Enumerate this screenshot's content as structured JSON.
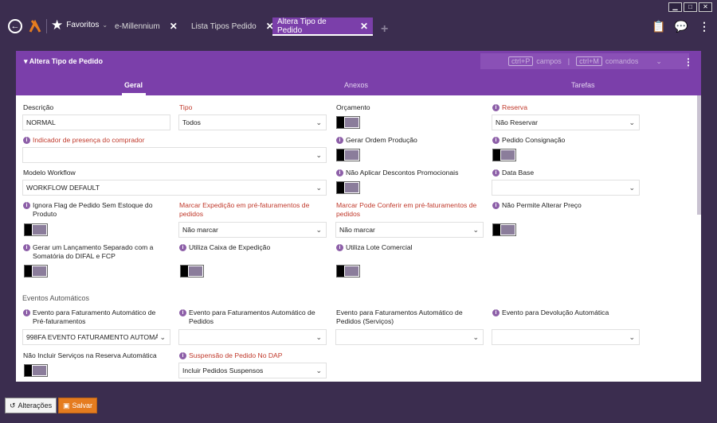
{
  "window": {
    "min": "▁",
    "max": "□",
    "close": "✕"
  },
  "nav": {
    "favorites_label": "Favoritos",
    "tabs": [
      {
        "label": "e-Millennium"
      },
      {
        "label": "Lista Tipos Pedido"
      },
      {
        "label": "Altera Tipo de Pedido"
      }
    ]
  },
  "panel": {
    "title": "Altera Tipo de Pedido",
    "shortcut_key1": "ctrl+P",
    "shortcut_label1": "campos",
    "shortcut_sep": "|",
    "shortcut_key2": "ctrl+M",
    "shortcut_label2": "comandos",
    "subtabs": [
      "Geral",
      "Anexos",
      "Tarefas"
    ]
  },
  "form": {
    "descricao_label": "Descrição",
    "descricao_value": "NORMAL",
    "tipo_label": "Tipo",
    "tipo_value": "Todos",
    "orcamento_label": "Orçamento",
    "reserva_label": "Reserva",
    "reserva_value": "Não Reservar",
    "indicador_label": "Indicador de presença do comprador",
    "indicador_value": "",
    "gerar_ordem_label": "Gerar Ordem Produção",
    "pedido_consig_label": "Pedido Consignação",
    "modelo_workflow_label": "Modelo Workflow",
    "modelo_workflow_value": "WORKFLOW DEFAULT",
    "nao_aplicar_label": "Não Aplicar Descontos Promocionais",
    "data_base_label": "Data Base",
    "data_base_value": "",
    "ignora_flag_label1": "Ignora Flag de Pedido Sem Estoque do",
    "ignora_flag_label2": "Produto",
    "marcar_exp_label1": "Marcar Expedição em pré-faturamentos de",
    "marcar_exp_label2": "pedidos",
    "marcar_exp_value": "Não marcar",
    "marcar_conf_label1": "Marcar Pode Conferir em pré-faturamentos de",
    "marcar_conf_label2": "pedidos",
    "marcar_conf_value": "Não marcar",
    "nao_permite_label": "Não Permite Alterar Preço",
    "gerar_lanc_label1": "Gerar um Lançamento Separado com a",
    "gerar_lanc_label2": "Somatória do DIFAL e FCP",
    "utiliza_caixa_label": "Utiliza Caixa de Expedição",
    "utiliza_lote_label": "Utiliza Lote Comercial",
    "eventos_section": "Eventos Automáticos",
    "evento_pre_label1": "Evento para Faturamento Automático de",
    "evento_pre_label2": "Pré-faturamentos",
    "evento_pre_value": "998FA EVENTO FATURAMENTO AUTOMÁ",
    "evento_ped_label1": "Evento para Faturamentos Automático de",
    "evento_ped_label2": "Pedidos",
    "evento_ped_value": "",
    "evento_serv_label1": "Evento para Faturamentos Automático de",
    "evento_serv_label2": "Pedidos (Serviços)",
    "evento_serv_value": "",
    "evento_dev_label": "Evento para Devolução Automática",
    "evento_dev_value": "",
    "nao_incluir_label": "Não Incluir Serviços na Reserva Automática",
    "suspensao_label": "Suspensão de Pedido No DAP",
    "suspensao_value": "Incluir Pedidos Suspensos"
  },
  "footer": {
    "alteracoes_label": "Alterações",
    "salvar_label": "Salvar"
  },
  "colors": {
    "accent": "#7b3faa",
    "background": "#3b2d4f",
    "required": "#c0392b",
    "save": "#e57c1f"
  }
}
